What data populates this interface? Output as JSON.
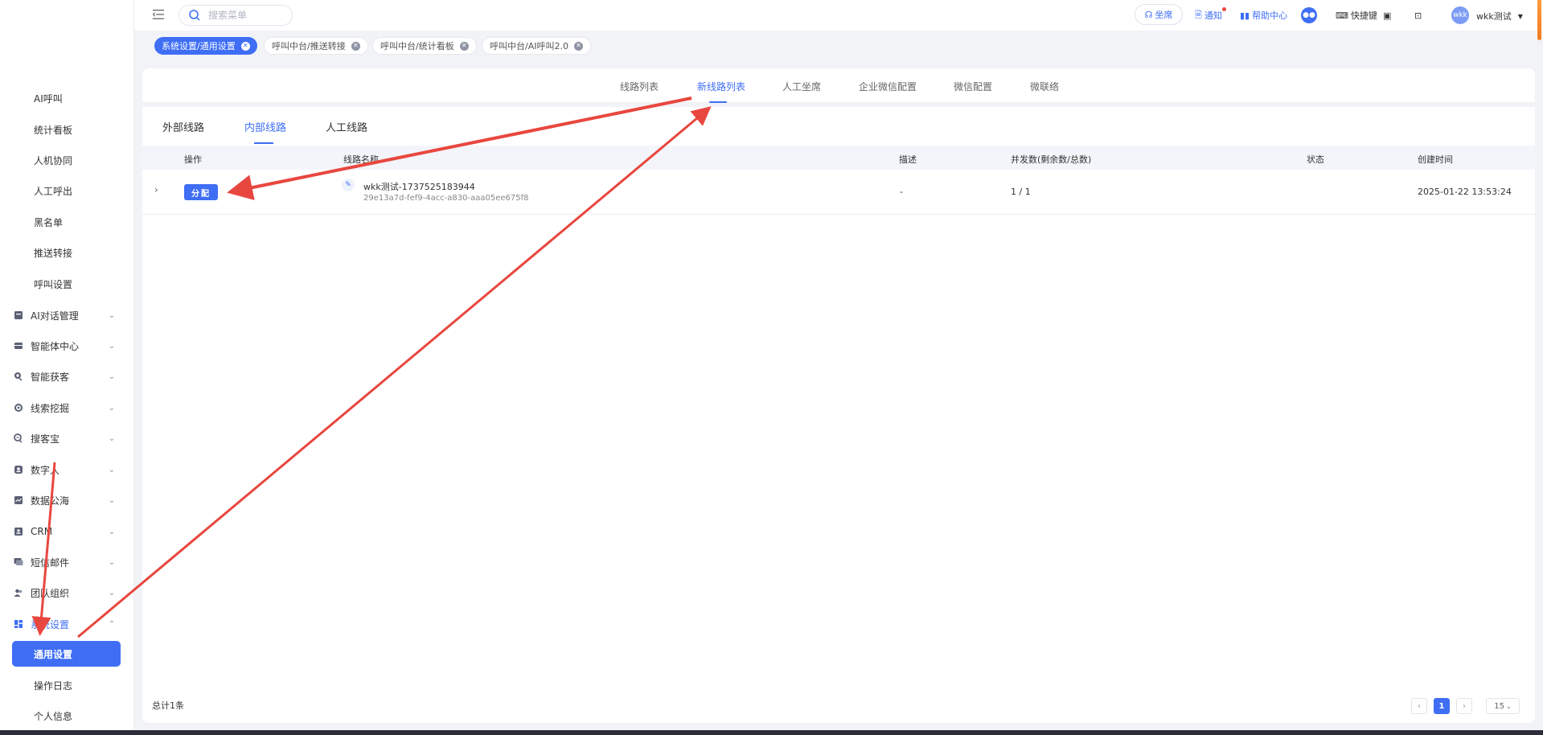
{
  "sidebar": {
    "sub_items_top": [
      "AI呼叫",
      "统计看板",
      "人机协同",
      "人工呼出",
      "黑名单",
      "推送转接",
      "呼叫设置"
    ],
    "groups": [
      {
        "label": "AI对话管理",
        "icon": "document-icon"
      },
      {
        "label": "智能体中心",
        "icon": "inbox-icon"
      },
      {
        "label": "智能获客",
        "icon": "magnify-icon"
      },
      {
        "label": "线索挖掘",
        "icon": "target-icon"
      },
      {
        "label": "搜客宝",
        "icon": "search-plus-icon"
      },
      {
        "label": "数字人",
        "icon": "person-badge-icon"
      },
      {
        "label": "数据公海",
        "icon": "chart-line-icon"
      },
      {
        "label": "CRM",
        "icon": "contact-card-icon"
      },
      {
        "label": "短信邮件",
        "icon": "message-icon"
      },
      {
        "label": "团队组织",
        "icon": "team-icon"
      },
      {
        "label": "系统设置",
        "icon": "dashboard-icon"
      }
    ],
    "sub_items_bottom": [
      "通用设置",
      "操作日志",
      "个人信息"
    ]
  },
  "topbar": {
    "search_placeholder": "搜索菜单",
    "seat": "坐席",
    "notice": "通知",
    "help": "帮助中心",
    "shortcut": "快捷键",
    "avatar_text": "wkk",
    "user": "wkk测试"
  },
  "tags": [
    {
      "label": "系统设置/通用设置",
      "active": true
    },
    {
      "label": "呼叫中台/推送转接",
      "active": false
    },
    {
      "label": "呼叫中台/统计看板",
      "active": false
    },
    {
      "label": "呼叫中台/AI呼叫2.0",
      "active": false
    }
  ],
  "top_tabs": [
    "线路列表",
    "新线路列表",
    "人工坐席",
    "企业微信配置",
    "微信配置",
    "微联络"
  ],
  "top_tab_active": "新线路列表",
  "sub_tabs": [
    "外部线路",
    "内部线路",
    "人工线路"
  ],
  "sub_tab_active": "内部线路",
  "table": {
    "headers": [
      "操作",
      "线路名称",
      "描述",
      "并发数(剩余数/总数)",
      "状态",
      "创建时间"
    ],
    "rows": [
      {
        "action": "分配",
        "name": "wkk测试-1737525183944",
        "id": "29e13a7d-fef9-4acc-a830-aaa05ee675f8",
        "desc": "-",
        "concurrency": "1 / 1",
        "status": "",
        "created": "2025-01-22 13:53:24"
      }
    ]
  },
  "footer": {
    "total": "总计1条",
    "current_page": "1",
    "page_size": "15"
  },
  "colors": {
    "accent": "#3f6ef5",
    "annotation_arrow": "#e8473f"
  }
}
